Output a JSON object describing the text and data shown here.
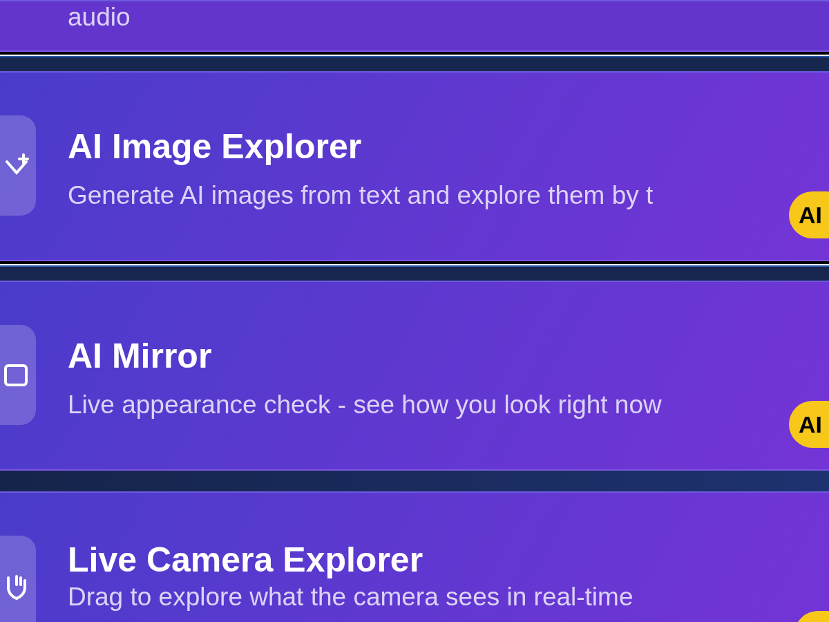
{
  "cards": [
    {
      "description": "audio"
    },
    {
      "title": "AI Image Explorer",
      "description": "Generate AI images from text and explore them by t",
      "badge": "AI"
    },
    {
      "title": "AI Mirror",
      "description": "Live appearance check - see how you look right now",
      "badge": "AI"
    },
    {
      "title": "Live Camera Explorer",
      "description": "Drag to explore what the camera sees in real-time",
      "has_badge": true
    }
  ]
}
